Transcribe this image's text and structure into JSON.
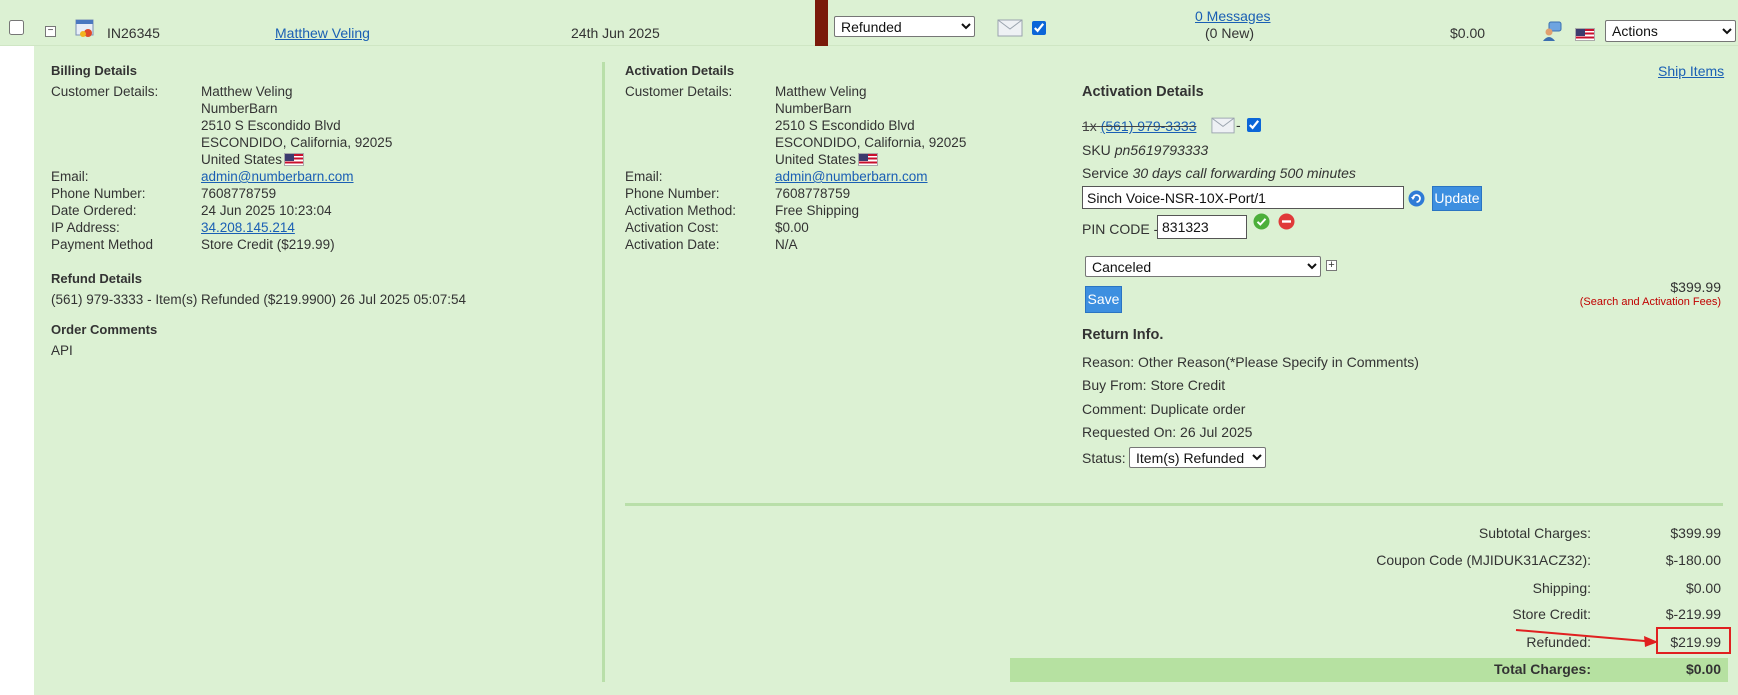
{
  "order": {
    "id": "IN26345",
    "customer_link": "Matthew Veling",
    "date": "24th Jun 2025",
    "status_select": "Refunded",
    "messages_link": "0 Messages",
    "messages_new": "(0 New)",
    "amount": "$0.00",
    "actions_select": "Actions"
  },
  "billing": {
    "title": "Billing Details",
    "customer_details_label": "Customer Details:",
    "name": "Matthew Veling",
    "company": "NumberBarn",
    "street": "2510 S Escondido Blvd",
    "city_line": "ESCONDIDO, California, 92025",
    "country": "United States",
    "email_label": "Email:",
    "email": "admin@numberbarn.com",
    "phone_label": "Phone Number:",
    "phone": "7608778759",
    "date_ordered_label": "Date Ordered:",
    "date_ordered": "24 Jun 2025 10:23:04",
    "ip_label": "IP Address:",
    "ip": "34.208.145.214",
    "payment_label": "Payment Method",
    "payment": "Store Credit ($219.99)"
  },
  "refund": {
    "title": "Refund Details",
    "line": "(561) 979-3333 - Item(s) Refunded ($219.9900) 26 Jul 2025 05:07:54"
  },
  "comments": {
    "title": "Order Comments",
    "text": "API"
  },
  "activation": {
    "title": "Activation Details",
    "customer_details_label": "Customer Details:",
    "name": "Matthew Veling",
    "company": "NumberBarn",
    "street": "2510 S Escondido Blvd",
    "city_line": "ESCONDIDO, California, 92025",
    "country": "United States",
    "email_label": "Email:",
    "email": "admin@numberbarn.com",
    "phone_label": "Phone Number:",
    "phone": "7608778759",
    "method_label": "Activation Method:",
    "method": "Free Shipping",
    "cost_label": "Activation Cost:",
    "cost": "$0.00",
    "date_label": "Activation Date:",
    "date": "N/A"
  },
  "item": {
    "title": "Activation Details",
    "ship_items_link": "Ship Items",
    "qty_prefix": "1x",
    "number": "(561) 979-3333",
    "dash": "-",
    "sku_label": "SKU",
    "sku": "pn5619793333",
    "service_label": "Service",
    "service": "30 days call forwarding 500 minutes",
    "carrier_value": "Sinch Voice-NSR-10X-Port/1",
    "update_label": "Update",
    "pin_label": "PIN CODE -",
    "pin_value": "831323",
    "status_select": "Canceled",
    "plus": "+",
    "save_label": "Save",
    "price": "$399.99",
    "fee_note": "(Search and Activation Fees)"
  },
  "return_info": {
    "title": "Return Info.",
    "reason": "Reason: Other Reason(*Please Specify in Comments)",
    "buy_from": "Buy From: Store Credit",
    "comment": "Comment: Duplicate order",
    "requested_on": "Requested On: 26 Jul 2025",
    "status_label": "Status:",
    "status_select": "Item(s) Refunded"
  },
  "totals": {
    "subtotal_label": "Subtotal Charges:",
    "subtotal": "$399.99",
    "coupon_label": "Coupon Code (MJIDUK31ACZ32):",
    "coupon": "$-180.00",
    "shipping_label": "Shipping:",
    "shipping": "$0.00",
    "store_credit_label": "Store Credit:",
    "store_credit": "$-219.99",
    "refunded_label": "Refunded:",
    "refunded": "$219.99",
    "total_label": "Total Charges:",
    "total": "$0.00"
  },
  "colors": {
    "panel_bg": "#dcf1d3",
    "divider": "#b9dfa9",
    "link": "#1a5fb4",
    "button": "#3d8fe0",
    "fee_note": "#c00000",
    "annotation": "#e02020",
    "status_strip": "#7a1a0a"
  },
  "icons": [
    "order-icon",
    "mail-icon",
    "refresh-icon",
    "check-icon",
    "remove-icon",
    "chat-user-icon",
    "us-flag-icon",
    "arrow-annotation"
  ]
}
